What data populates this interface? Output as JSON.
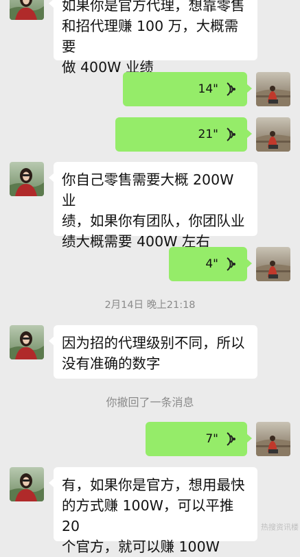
{
  "messages": [
    {
      "side": "in",
      "lines": [
        "如果你是官方代理，想靠零售",
        "和招代理赚 100 万，大概需要",
        "做 400W 业绩"
      ]
    },
    {
      "side": "out",
      "type": "voice",
      "duration": "14\""
    },
    {
      "side": "out",
      "type": "voice",
      "duration": "21\""
    },
    {
      "side": "in",
      "lines": [
        "你自己零售需要大概 200W 业",
        "绩，如果你有团队，你团队业",
        "绩大概需要 400W 左右"
      ]
    },
    {
      "side": "out",
      "type": "voice",
      "duration": "4\""
    },
    {
      "side": "in",
      "lines": [
        "因为招的代理级别不同，所以",
        "没有准确的数字"
      ]
    },
    {
      "side": "out",
      "type": "voice",
      "duration": "7\""
    },
    {
      "side": "in",
      "lines": [
        "有，如果你是官方，想用最快",
        "的方式赚 100W，可以平推 20",
        "个官方，就可以赚 100W"
      ]
    }
  ],
  "system": {
    "timestamp": "2月14日 晚上21:18",
    "recall": "你撤回了一条消息"
  },
  "icons": {
    "voice": "voice-wave-icon",
    "avatar": "user-avatar"
  },
  "colors": {
    "background": "#ebebeb",
    "outgoing": "#95ec69",
    "incoming": "#ffffff",
    "system_text": "#8a8a8a"
  },
  "watermark": "热搜资讯楼"
}
